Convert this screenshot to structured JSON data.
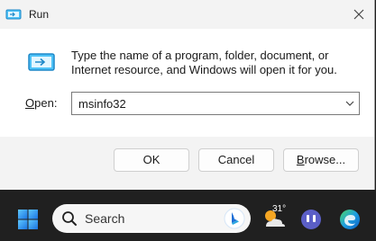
{
  "window": {
    "title": "Run"
  },
  "dialog": {
    "description": "Type the name of a program, folder, document, or Internet resource, and Windows will open it for you.",
    "open_label_hotkey": "O",
    "open_label_rest": "pen:",
    "open_value": "msinfo32"
  },
  "buttons": {
    "ok": "OK",
    "cancel": "Cancel",
    "browse_hotkey": "B",
    "browse_rest": "rowse..."
  },
  "taskbar": {
    "search_placeholder": "Search",
    "weather_temp": "31°"
  },
  "icons": {
    "run": "run-icon",
    "close": "close-icon",
    "dropdown": "chevron-down-icon",
    "start": "windows-start-icon",
    "search": "search-icon",
    "bing": "bing-icon",
    "weather": "weather-icon",
    "teams": "teams-chat-icon",
    "edge": "edge-icon"
  },
  "colors": {
    "accent": "#1a6fd0",
    "taskbar": "#202020",
    "dialog_bg": "#f3f3f3",
    "content_bg": "#ffffff"
  }
}
